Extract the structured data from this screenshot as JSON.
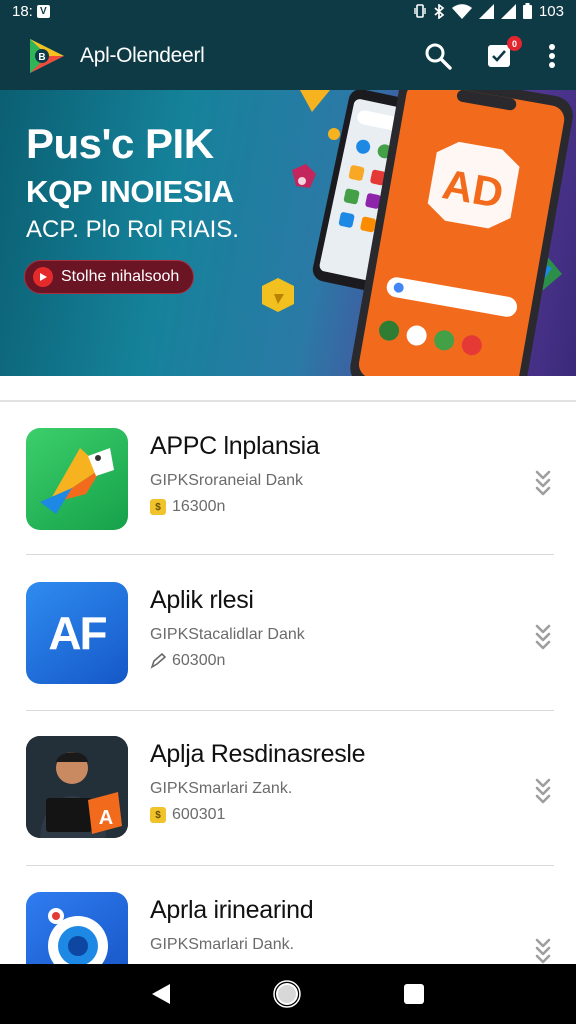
{
  "status_bar": {
    "time": "18:",
    "notification_glyph": "V",
    "battery": "103",
    "icons": [
      "notification-icon",
      "vibrate-icon",
      "bluetooth-icon",
      "wifi-icon",
      "signal-icon",
      "signal-icon",
      "battery-icon"
    ]
  },
  "app_bar": {
    "title": "Apl-Olendeerl",
    "logo_icon": "play-logo-icon",
    "actions": [
      "search-icon",
      "inbox-icon",
      "more-vert-icon"
    ],
    "notification_count": "0"
  },
  "banner": {
    "headline": "Pus'c PIK",
    "sub1": "KQP INOIESIA",
    "sub2": "ACP. Plo Rol RIAIS.",
    "cta_label": "Stolhe nihalsooh",
    "phone_logo": "AD"
  },
  "apps": [
    {
      "name": "APPC lnplansia",
      "developer": "GIPKSroraneial Dank",
      "meta": "16300n",
      "meta_icon": "coin-badge-icon",
      "icon": "green-app-icon"
    },
    {
      "name": "Aplik rlesi",
      "developer": "GIPKStacalidlar Dank",
      "meta": "60300n",
      "meta_icon": "edit-icon",
      "icon_text": "AF",
      "icon": "af-app-icon"
    },
    {
      "name": "Aplja Resdinasresle",
      "developer": "GIPKSmarlari Zank.",
      "meta": "600301",
      "meta_icon": "coin-badge-icon",
      "icon": "person-app-icon"
    },
    {
      "name": "Aprla irinearind",
      "developer": "GIPKSmarlari Dank.",
      "meta": "",
      "meta_icon": "",
      "icon": "blue-circle-app-icon"
    }
  ],
  "colors": {
    "app_bar_bg": "#0e3a45",
    "banner_orange": "#f26b1d",
    "cta_bg": "#6a1424",
    "text_primary": "#111111",
    "text_secondary": "#6b6b6b"
  },
  "nav_bar": {
    "buttons": [
      "back-icon",
      "home-icon",
      "recents-icon"
    ]
  }
}
